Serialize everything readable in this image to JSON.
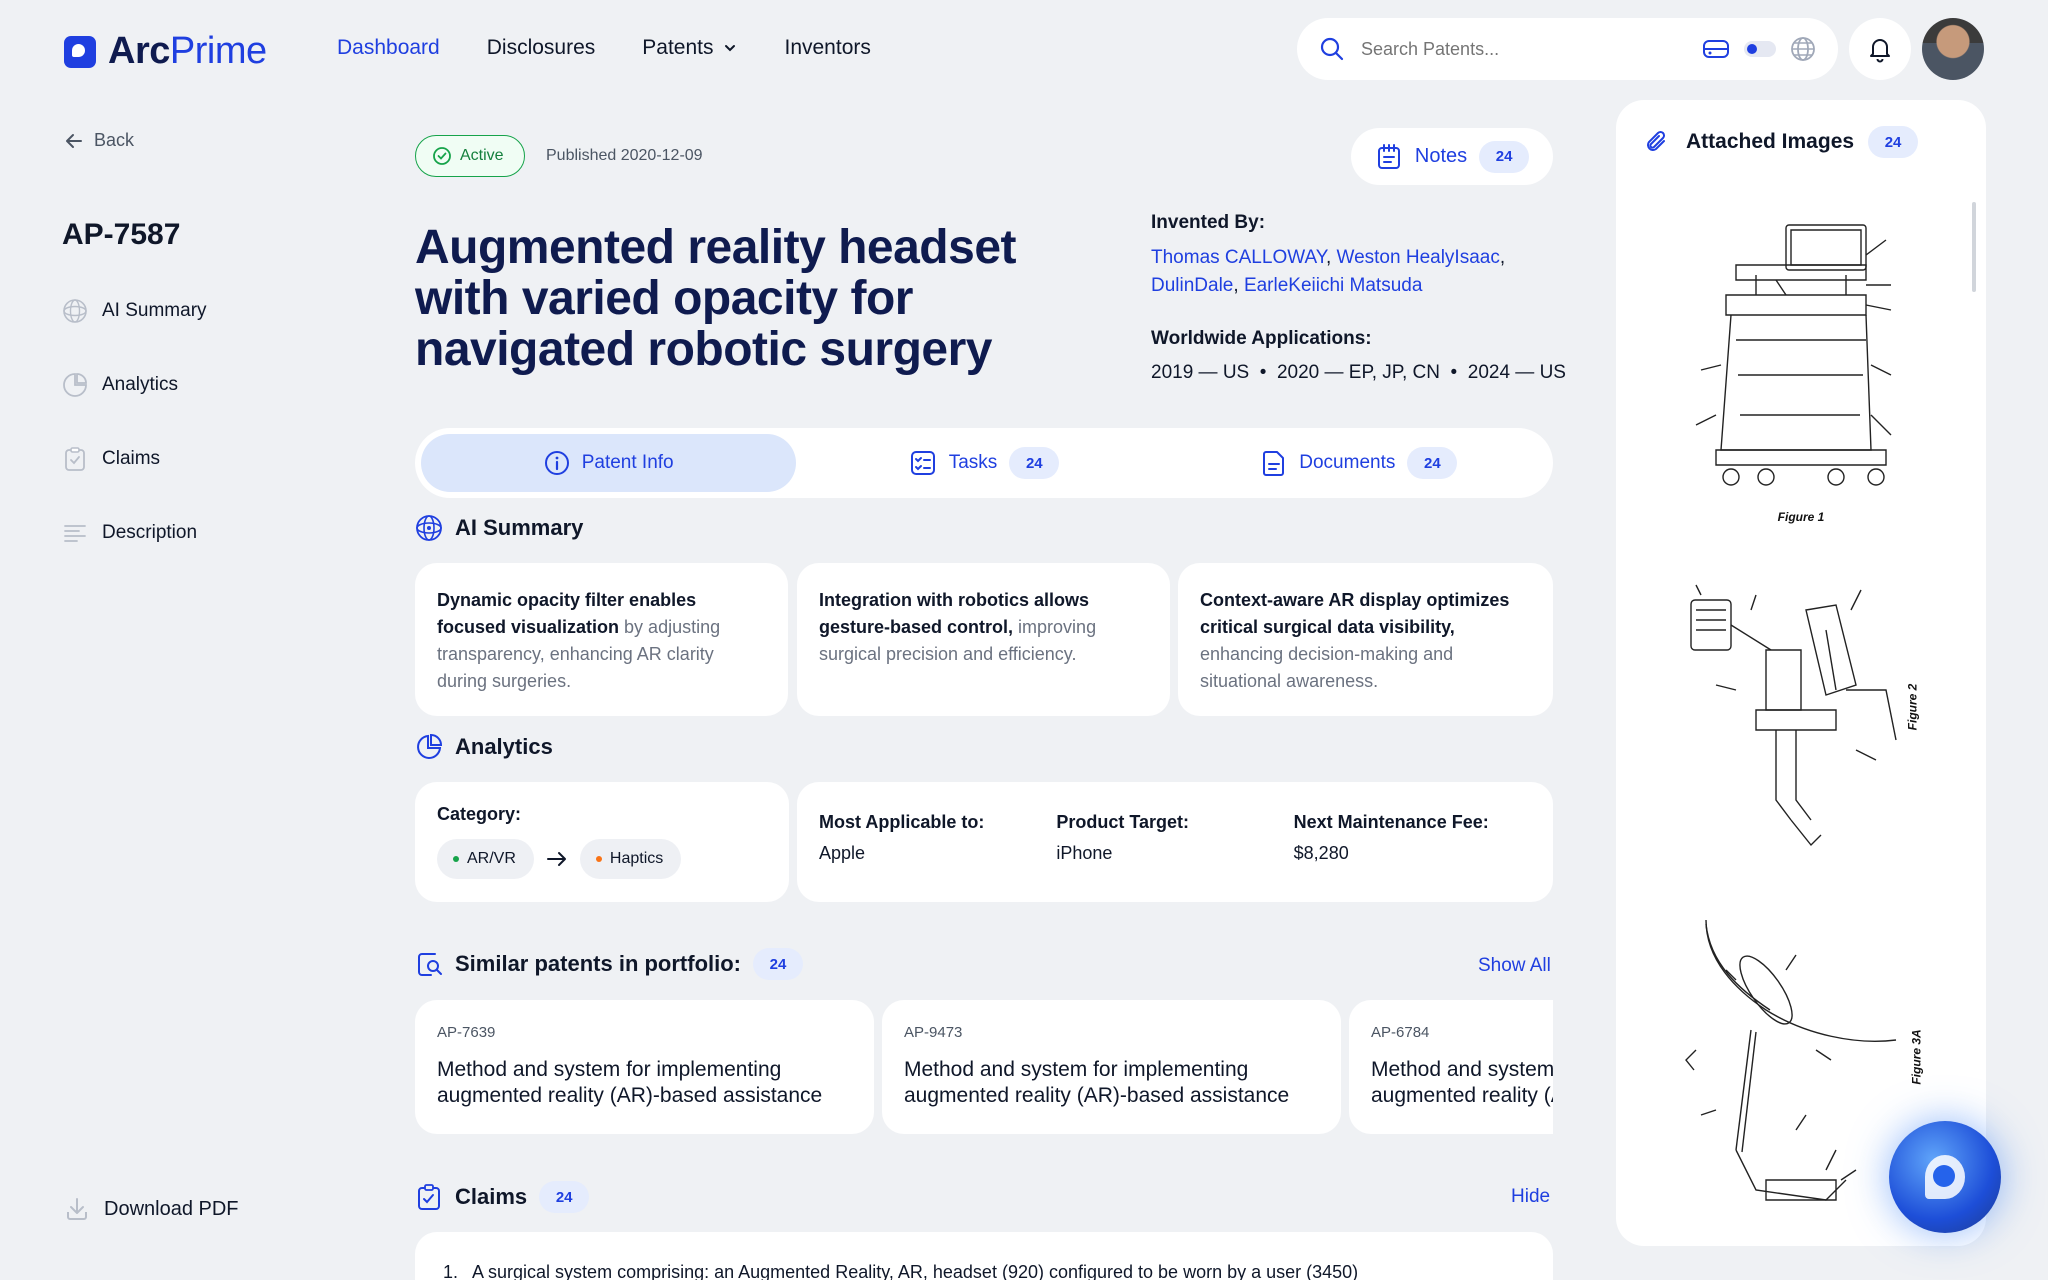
{
  "brand": {
    "name_part1": "Arc",
    "name_part2": "Prime"
  },
  "nav": {
    "items": [
      "Dashboard",
      "Disclosures",
      "Patents",
      "Inventors"
    ],
    "active": "Dashboard"
  },
  "search": {
    "placeholder": "Search Patents..."
  },
  "sidebar": {
    "back": "Back",
    "patent_id": "AP-7587",
    "items": [
      "AI Summary",
      "Analytics",
      "Claims",
      "Description"
    ],
    "download": "Download PDF"
  },
  "patent": {
    "status": "Active",
    "published": "Published 2020-12-09",
    "title": "Augmented reality headset with varied opacity for navigated robotic surgery",
    "invented_by_label": "Invented By:",
    "inventors": [
      "Thomas CALLOWAY",
      "Weston HealyIsaac",
      "DulinDale",
      "EarleKeiichi Matsuda"
    ],
    "worldwide_label": "Worldwide Applications:",
    "applications": "2019 — US  •  2020 — EP, JP, CN  •  2024 — US"
  },
  "notes": {
    "label": "Notes",
    "count": "24"
  },
  "tabs": [
    {
      "label": "Patent Info",
      "count": ""
    },
    {
      "label": "Tasks",
      "count": "24"
    },
    {
      "label": "Documents",
      "count": "24"
    }
  ],
  "ai_summary": {
    "heading": "AI Summary",
    "cards": [
      {
        "bold": "Dynamic opacity filter enables focused visualization",
        "rest": " by adjusting transparency, enhancing AR clarity during surgeries."
      },
      {
        "bold": "Integration with robotics allows gesture-based control,",
        "rest": " improving surgical precision and efficiency."
      },
      {
        "bold": "Context-aware AR display optimizes critical surgical data visibility,",
        "rest": " enhancing decision-making and situational awareness."
      }
    ]
  },
  "analytics": {
    "heading": "Analytics",
    "category_label": "Category:",
    "category_from": "AR/VR",
    "category_to": "Haptics",
    "columns": [
      {
        "label": "Most Applicable to:",
        "value": "Apple"
      },
      {
        "label": "Product Target:",
        "value": "iPhone"
      },
      {
        "label": "Next Maintenance Fee:",
        "value": "$8,280"
      }
    ]
  },
  "similar": {
    "heading": "Similar patents in portfolio:",
    "count": "24",
    "show_all": "Show All",
    "items": [
      {
        "id": "AP-7639",
        "line1": "Method and system for implementing",
        "line2": "augmented reality (AR)-based assistance"
      },
      {
        "id": "AP-9473",
        "line1": "Method and system for implementing",
        "line2": "augmented reality (AR)-based assistance"
      },
      {
        "id": "AP-6784",
        "line1": "Method and system for implementing",
        "line2": "augmented reality (AR)-based assistance"
      }
    ]
  },
  "claims": {
    "heading": "Claims",
    "count": "24",
    "hide": "Hide",
    "first": "1.   A surgical system comprising: an Augmented Reality, AR, headset (920) configured to be worn by a user (3450)"
  },
  "images": {
    "heading": "Attached Images",
    "count": "24",
    "figures": [
      "Figure 1",
      "Figure 2",
      "Figure 3A"
    ]
  },
  "colors": {
    "accent": "#1f3fe0",
    "active_green": "#16a34a",
    "chip_dot_from": "#16a34a",
    "chip_dot_to": "#f97316"
  }
}
